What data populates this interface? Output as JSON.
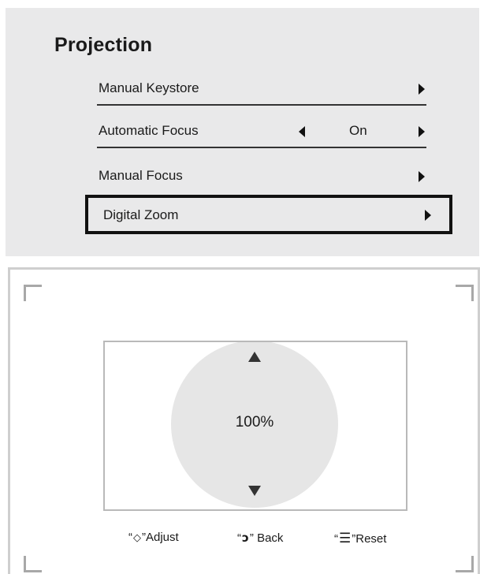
{
  "menu": {
    "title": "Projection",
    "items": [
      {
        "label": "Manual Keystore",
        "has_submenu": true
      },
      {
        "label": "Automatic Focus",
        "value": "On"
      },
      {
        "label": "Manual Focus",
        "has_submenu": true
      },
      {
        "label": "Digital Zoom",
        "has_submenu": true,
        "selected": true
      }
    ]
  },
  "zoom": {
    "value": "100%",
    "icons": {
      "up": "arrow-up-icon",
      "down": "arrow-down-icon"
    }
  },
  "hints": {
    "adjust": {
      "icon_glyph": "◇",
      "icon_name": "dpad-icon",
      "label": "Adjust"
    },
    "back": {
      "icon_glyph": "ↄ",
      "icon_name": "back-icon",
      "label": " Back"
    },
    "reset": {
      "icon_glyph": "☰",
      "icon_name": "menu-icon",
      "label": "Reset"
    }
  },
  "colors": {
    "menu_background": "#e9e9ea",
    "selection_border": "#111111",
    "dial_fill": "#e6e6e6",
    "frame_border": "#b9b9b9"
  }
}
